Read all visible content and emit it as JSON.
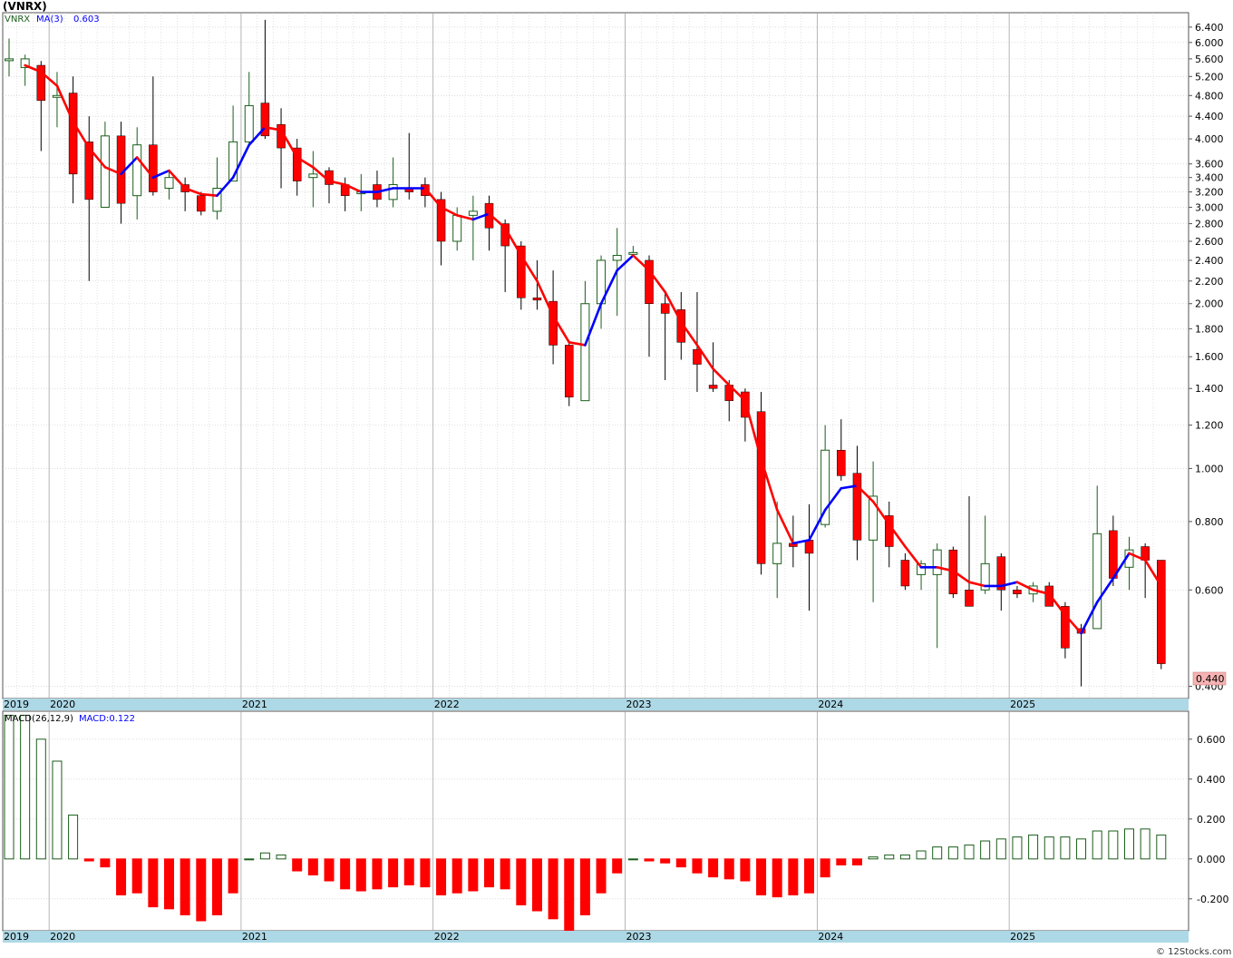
{
  "title": "(VNRX)",
  "footer": "© 12Stocks.com",
  "colors": {
    "up": "#1a5e1a",
    "down": "#ff0000",
    "ma_up": "#0000ff",
    "ma_down": "#ff0000",
    "grid": "#c8c8c8",
    "axis_band": "#add8e6",
    "price_box": "#f7b2b2"
  },
  "chart_data": [
    {
      "type": "candlestick",
      "legend": {
        "symbol": "VNRX",
        "ma_label": "MA(3)",
        "ma_value": "0.603"
      },
      "scale": "log",
      "ylim": [
        0.38,
        6.8
      ],
      "y_ticks": [
        "6.400",
        "6.000",
        "5.600",
        "5.200",
        "4.800",
        "4.400",
        "4.000",
        "3.600",
        "3.400",
        "3.200",
        "3.000",
        "2.800",
        "2.600",
        "2.400",
        "2.200",
        "2.000",
        "1.800",
        "1.600",
        "1.400",
        "1.200",
        "1.000",
        "0.800",
        "0.600",
        "0.400"
      ],
      "last_price": "0.440",
      "x_tick_labels": [
        "2019",
        "2020",
        "2021",
        "2022",
        "2023",
        "2024",
        "2025"
      ],
      "candles": [
        {
          "date": "2019-10",
          "o": 5.6,
          "h": 6.1,
          "l": 5.2,
          "c": 5.6
        },
        {
          "date": "2019-11",
          "o": 5.4,
          "h": 5.7,
          "l": 5.0,
          "c": 5.6
        },
        {
          "date": "2019-12",
          "o": 5.45,
          "h": 5.55,
          "l": 3.8,
          "c": 4.7
        },
        {
          "date": "2020-01",
          "o": 4.8,
          "h": 5.3,
          "l": 4.2,
          "c": 4.8
        },
        {
          "date": "2020-02",
          "o": 4.85,
          "h": 5.2,
          "l": 3.05,
          "c": 3.45
        },
        {
          "date": "2020-03",
          "o": 3.95,
          "h": 4.4,
          "l": 2.2,
          "c": 3.1
        },
        {
          "date": "2020-04",
          "o": 3.0,
          "h": 4.3,
          "l": 3.0,
          "c": 4.05
        },
        {
          "date": "2020-05",
          "o": 4.05,
          "h": 4.3,
          "l": 2.8,
          "c": 3.05
        },
        {
          "date": "2020-06",
          "o": 3.15,
          "h": 4.2,
          "l": 2.85,
          "c": 3.9
        },
        {
          "date": "2020-07",
          "o": 3.9,
          "h": 5.2,
          "l": 3.15,
          "c": 3.2
        },
        {
          "date": "2020-08",
          "o": 3.25,
          "h": 3.5,
          "l": 3.1,
          "c": 3.4
        },
        {
          "date": "2020-09",
          "o": 3.3,
          "h": 3.4,
          "l": 2.95,
          "c": 3.2
        },
        {
          "date": "2020-10",
          "o": 3.15,
          "h": 3.2,
          "l": 2.9,
          "c": 2.95
        },
        {
          "date": "2020-11",
          "o": 2.95,
          "h": 3.7,
          "l": 2.85,
          "c": 3.25
        },
        {
          "date": "2020-12",
          "o": 3.35,
          "h": 4.6,
          "l": 3.35,
          "c": 3.95
        },
        {
          "date": "2021-01",
          "o": 3.95,
          "h": 5.3,
          "l": 3.9,
          "c": 4.6
        },
        {
          "date": "2021-02",
          "o": 4.65,
          "h": 6.6,
          "l": 4.0,
          "c": 4.05
        },
        {
          "date": "2021-03",
          "o": 4.25,
          "h": 4.55,
          "l": 3.25,
          "c": 3.85
        },
        {
          "date": "2021-04",
          "o": 3.85,
          "h": 4.0,
          "l": 3.15,
          "c": 3.35
        },
        {
          "date": "2021-05",
          "o": 3.4,
          "h": 3.8,
          "l": 3.0,
          "c": 3.45
        },
        {
          "date": "2021-06",
          "o": 3.5,
          "h": 3.55,
          "l": 3.05,
          "c": 3.3
        },
        {
          "date": "2021-07",
          "o": 3.3,
          "h": 3.4,
          "l": 2.95,
          "c": 3.15
        },
        {
          "date": "2021-08",
          "o": 3.2,
          "h": 3.45,
          "l": 2.95,
          "c": 3.2
        },
        {
          "date": "2021-09",
          "o": 3.3,
          "h": 3.5,
          "l": 3.0,
          "c": 3.1
        },
        {
          "date": "2021-10",
          "o": 3.1,
          "h": 3.7,
          "l": 3.0,
          "c": 3.3
        },
        {
          "date": "2021-11",
          "o": 3.25,
          "h": 4.1,
          "l": 3.1,
          "c": 3.2
        },
        {
          "date": "2021-12",
          "o": 3.3,
          "h": 3.4,
          "l": 3.0,
          "c": 3.15
        },
        {
          "date": "2022-01",
          "o": 3.1,
          "h": 3.2,
          "l": 2.35,
          "c": 2.6
        },
        {
          "date": "2022-02",
          "o": 2.6,
          "h": 3.0,
          "l": 2.5,
          "c": 2.9
        },
        {
          "date": "2022-03",
          "o": 2.9,
          "h": 3.15,
          "l": 2.4,
          "c": 2.95
        },
        {
          "date": "2022-04",
          "o": 3.05,
          "h": 3.15,
          "l": 2.5,
          "c": 2.75
        },
        {
          "date": "2022-05",
          "o": 2.8,
          "h": 2.85,
          "l": 2.1,
          "c": 2.55
        },
        {
          "date": "2022-06",
          "o": 2.55,
          "h": 2.6,
          "l": 1.95,
          "c": 2.05
        },
        {
          "date": "2022-07",
          "o": 2.05,
          "h": 2.4,
          "l": 1.95,
          "c": 2.03
        },
        {
          "date": "2022-08",
          "o": 2.02,
          "h": 2.3,
          "l": 1.55,
          "c": 1.68
        },
        {
          "date": "2022-09",
          "o": 1.68,
          "h": 1.7,
          "l": 1.3,
          "c": 1.35
        },
        {
          "date": "2022-10",
          "o": 1.33,
          "h": 2.2,
          "l": 1.33,
          "c": 2.0
        },
        {
          "date": "2022-11",
          "o": 2.0,
          "h": 2.45,
          "l": 1.8,
          "c": 2.4
        },
        {
          "date": "2022-12",
          "o": 2.4,
          "h": 2.75,
          "l": 1.9,
          "c": 2.45
        },
        {
          "date": "2023-01",
          "o": 2.48,
          "h": 2.55,
          "l": 2.48,
          "c": 2.48
        },
        {
          "date": "2023-02",
          "o": 2.4,
          "h": 2.45,
          "l": 1.6,
          "c": 2.0
        },
        {
          "date": "2023-03",
          "o": 2.0,
          "h": 2.1,
          "l": 1.45,
          "c": 1.92
        },
        {
          "date": "2023-04",
          "o": 1.95,
          "h": 2.1,
          "l": 1.58,
          "c": 1.7
        },
        {
          "date": "2023-05",
          "o": 1.65,
          "h": 2.1,
          "l": 1.38,
          "c": 1.55
        },
        {
          "date": "2023-06",
          "o": 1.42,
          "h": 1.7,
          "l": 1.38,
          "c": 1.4
        },
        {
          "date": "2023-07",
          "o": 1.42,
          "h": 1.45,
          "l": 1.22,
          "c": 1.33
        },
        {
          "date": "2023-08",
          "o": 1.38,
          "h": 1.4,
          "l": 1.12,
          "c": 1.24
        },
        {
          "date": "2023-09",
          "o": 1.27,
          "h": 1.38,
          "l": 0.64,
          "c": 0.67
        },
        {
          "date": "2023-10",
          "o": 0.67,
          "h": 0.87,
          "l": 0.58,
          "c": 0.73
        },
        {
          "date": "2023-11",
          "o": 0.73,
          "h": 0.82,
          "l": 0.66,
          "c": 0.72
        },
        {
          "date": "2023-12",
          "o": 0.74,
          "h": 0.86,
          "l": 0.55,
          "c": 0.7
        },
        {
          "date": "2024-01",
          "o": 0.79,
          "h": 1.2,
          "l": 0.78,
          "c": 1.08
        },
        {
          "date": "2024-02",
          "o": 1.08,
          "h": 1.23,
          "l": 0.95,
          "c": 0.97
        },
        {
          "date": "2024-03",
          "o": 0.98,
          "h": 1.1,
          "l": 0.68,
          "c": 0.74
        },
        {
          "date": "2024-04",
          "o": 0.74,
          "h": 1.03,
          "l": 0.57,
          "c": 0.89
        },
        {
          "date": "2024-05",
          "o": 0.82,
          "h": 0.87,
          "l": 0.66,
          "c": 0.72
        },
        {
          "date": "2024-06",
          "o": 0.68,
          "h": 0.7,
          "l": 0.6,
          "c": 0.61
        },
        {
          "date": "2024-07",
          "o": 0.64,
          "h": 0.68,
          "l": 0.6,
          "c": 0.67
        },
        {
          "date": "2024-08",
          "o": 0.64,
          "h": 0.73,
          "l": 0.47,
          "c": 0.71
        },
        {
          "date": "2024-09",
          "o": 0.71,
          "h": 0.72,
          "l": 0.58,
          "c": 0.59
        },
        {
          "date": "2024-10",
          "o": 0.6,
          "h": 0.89,
          "l": 0.57,
          "c": 0.56
        },
        {
          "date": "2024-11",
          "o": 0.6,
          "h": 0.82,
          "l": 0.59,
          "c": 0.67
        },
        {
          "date": "2024-12",
          "o": 0.69,
          "h": 0.7,
          "l": 0.55,
          "c": 0.6
        },
        {
          "date": "2025-01",
          "o": 0.6,
          "h": 0.61,
          "l": 0.58,
          "c": 0.59
        },
        {
          "date": "2025-02",
          "o": 0.59,
          "h": 0.62,
          "l": 0.57,
          "c": 0.61
        },
        {
          "date": "2025-03",
          "o": 0.61,
          "h": 0.62,
          "l": 0.56,
          "c": 0.56
        },
        {
          "date": "2025-04",
          "o": 0.56,
          "h": 0.57,
          "l": 0.45,
          "c": 0.47
        },
        {
          "date": "2025-05",
          "o": 0.51,
          "h": 0.52,
          "l": 0.4,
          "c": 0.5
        },
        {
          "date": "2025-06",
          "o": 0.51,
          "h": 0.93,
          "l": 0.51,
          "c": 0.76
        },
        {
          "date": "2025-07",
          "o": 0.77,
          "h": 0.82,
          "l": 0.61,
          "c": 0.63
        },
        {
          "date": "2025-08",
          "o": 0.66,
          "h": 0.75,
          "l": 0.6,
          "c": 0.71
        },
        {
          "date": "2025-09",
          "o": 0.72,
          "h": 0.73,
          "l": 0.58,
          "c": 0.68
        },
        {
          "date": "2025-10",
          "o": 0.68,
          "h": 0.68,
          "l": 0.43,
          "c": 0.44
        }
      ],
      "ma": [
        null,
        5.45,
        5.3,
        5.0,
        4.3,
        3.85,
        3.55,
        3.45,
        3.7,
        3.4,
        3.5,
        3.25,
        3.17,
        3.15,
        3.4,
        3.9,
        4.2,
        4.15,
        3.7,
        3.55,
        3.35,
        3.3,
        3.2,
        3.2,
        3.25,
        3.25,
        3.25,
        3.0,
        2.9,
        2.85,
        2.92,
        2.75,
        2.45,
        2.2,
        1.9,
        1.7,
        1.68,
        2.0,
        2.3,
        2.45,
        2.3,
        2.1,
        1.85,
        1.68,
        1.52,
        1.42,
        1.33,
        1.04,
        0.84,
        0.73,
        0.74,
        0.84,
        0.92,
        0.93,
        0.87,
        0.79,
        0.72,
        0.66,
        0.66,
        0.65,
        0.62,
        0.61,
        0.61,
        0.62,
        0.6,
        0.59,
        0.54,
        0.5,
        0.57,
        0.63,
        0.7,
        0.68,
        0.61
      ]
    },
    {
      "type": "bar",
      "legend": {
        "label": "MACD(26,12,9)",
        "value_label": "MACD:0.122"
      },
      "ylim": [
        -0.36,
        0.74
      ],
      "y_ticks": [
        "0.600",
        "0.400",
        "0.200",
        "0.000",
        "-0.200"
      ],
      "x_tick_labels": [
        "2019",
        "2020",
        "2021",
        "2022",
        "2023",
        "2024",
        "2025"
      ],
      "values": [
        0.72,
        0.72,
        0.6,
        0.49,
        0.22,
        -0.01,
        -0.04,
        -0.18,
        -0.17,
        -0.24,
        -0.25,
        -0.28,
        -0.31,
        -0.28,
        -0.17,
        0.0,
        0.03,
        0.02,
        -0.06,
        -0.08,
        -0.11,
        -0.15,
        -0.16,
        -0.15,
        -0.14,
        -0.13,
        -0.14,
        -0.18,
        -0.17,
        -0.16,
        -0.14,
        -0.15,
        -0.23,
        -0.26,
        -0.3,
        -0.36,
        -0.28,
        -0.17,
        -0.07,
        0.0,
        -0.01,
        -0.02,
        -0.04,
        -0.07,
        -0.09,
        -0.1,
        -0.11,
        -0.18,
        -0.19,
        -0.18,
        -0.17,
        -0.09,
        -0.03,
        -0.03,
        0.01,
        0.02,
        0.02,
        0.04,
        0.06,
        0.06,
        0.07,
        0.09,
        0.1,
        0.11,
        0.12,
        0.11,
        0.11,
        0.1,
        0.14,
        0.14,
        0.15,
        0.15,
        0.12
      ]
    }
  ]
}
